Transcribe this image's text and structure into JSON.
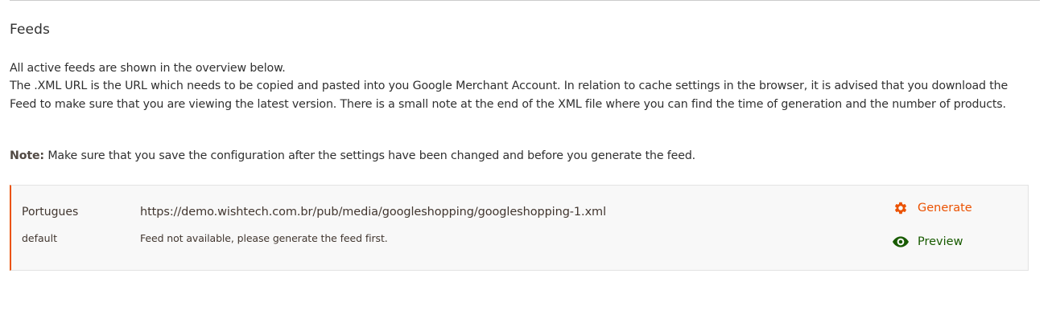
{
  "section": {
    "title": "Feeds"
  },
  "description": {
    "line1": "All active feeds are shown in the overview below.",
    "line2": "The .XML URL is the URL which needs to be copied and pasted into you Google Merchant Account. In relation to cache settings in the browser, it is advised that you download the Feed to make sure that you are viewing the latest version. There is a small note at the end of the XML file where you can find the time of generation and the number of products."
  },
  "note": {
    "label": "Note:",
    "text": " Make sure that you save the configuration after the settings have been changed and before you generate the feed."
  },
  "feeds": [
    {
      "store_name": "Portugues",
      "store_code": "default",
      "url": "https://demo.wishtech.com.br/pub/media/googleshopping/googleshopping-1.xml",
      "status": "Feed not available, please generate the feed first.",
      "generate_label": "Generate",
      "preview_label": "Preview",
      "generate_icon": "gear-icon",
      "preview_icon": "eye-icon"
    }
  ],
  "colors": {
    "accent": "#eb5202",
    "preview": "#185b00",
    "box_bg": "#f8f8f8"
  }
}
